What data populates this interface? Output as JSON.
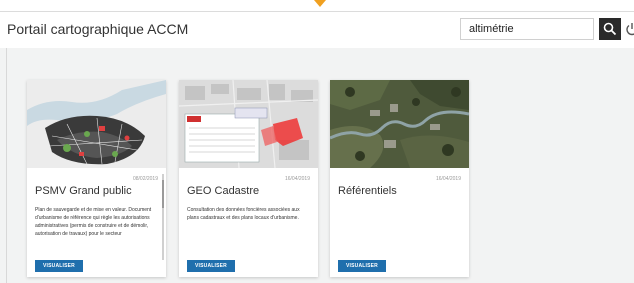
{
  "header": {
    "title": "Portail cartographique ACCM",
    "search_value": "altimétrie",
    "search_icon": "search-icon",
    "power_icon": "power-icon"
  },
  "colors": {
    "accent_marker": "#f0a020",
    "button": "#1f6fad",
    "search_button": "#2a2a2a",
    "background": "#f2f3f3"
  },
  "cards": [
    {
      "title": "PSMV Grand public",
      "date": "08/02/2019",
      "description": "Plan de sauvegarde et de mise en valeur. Document d'urbanisme de référence qui règle les autorisations administratives (permis de construire et de démolir, autorisation de travaux) pour le secteur",
      "button": "VISUALISER",
      "thumbnail": "map-thumbnail-psmv"
    },
    {
      "title": "GEO Cadastre",
      "date": "16/04/2019",
      "description": "Consultation des données foncières associées aux plans cadastraux et des plans locaux d'urbanisme.",
      "button": "VISUALISER",
      "thumbnail": "map-thumbnail-cadastre"
    },
    {
      "title": "Référentiels",
      "date": "16/04/2019",
      "description": "",
      "button": "VISUALISER",
      "thumbnail": "aerial-thumbnail-referentiels"
    }
  ]
}
